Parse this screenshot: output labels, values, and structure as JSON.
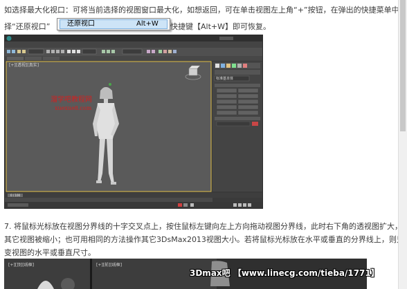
{
  "article": {
    "para1_line1": "如选择最大化视口：可将当前选择的视图窗口最大化，如想返回，可在单击视图左上角“+”按钮，在弹出的快捷菜单中选",
    "para1_line2_pre": "择“还原视口”",
    "para1_line2_post": "快捷键【Alt+W】即可恢复。",
    "para2_line1": "7. 将鼠标光标放在视图分界线的十字交叉点上，按住鼠标左键向左上方向拖动视图分界线，此时右下角的透视图扩大，而",
    "para2_line2": "其它视图被缩小；也可用相同的方法操作其它3DsMax2013视图大小。若将鼠标光标放在水平或垂直的分界线上，则只能改",
    "para2_line3": "变视图的水平或垂直尺寸。"
  },
  "context_menu": {
    "item_label": "还原视口",
    "shortcut": "Alt+W"
  },
  "max_ui": {
    "viewport_label": "[+][透视][真实]",
    "watermark_line1": "溜学吧教程网",
    "watermark_line2": "xuexue8.com",
    "frame_counter": "0 / 100",
    "right_panel_title": "标准基本体",
    "object_buttons": [
      "长方体",
      "圆锥体",
      "球体",
      "几何球体",
      "圆柱体",
      "管状体",
      "圆环",
      "四棱锥",
      "茶壶",
      "平面"
    ]
  },
  "second_screenshot": {
    "viewport_label_left": "[+][顶][线框]",
    "viewport_label_mid": "[+][前][线框]",
    "brand_text": "3Dmax吧 【www.linecg.com/tieba/1771】"
  },
  "colors": {
    "text": "#3a3a3a",
    "menu_highlight": "#cde4f7",
    "max_bg": "#4d4d4d",
    "viewport_bg": "#5a5a5a",
    "watermark": "#d22020"
  }
}
